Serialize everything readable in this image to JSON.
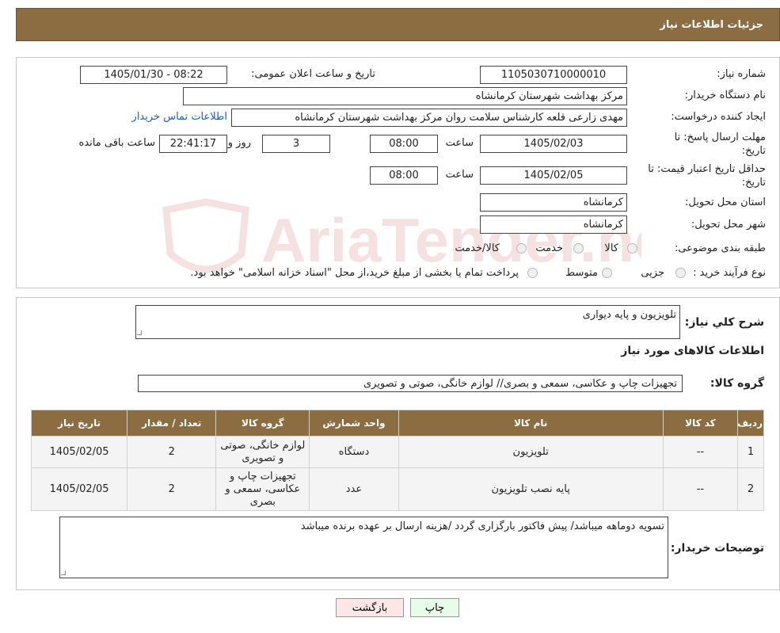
{
  "header": {
    "title": "جزئیات اطلاعات نیاز"
  },
  "watermark": {
    "text": "AriaTender.neT"
  },
  "form": {
    "need_number_label": "شماره نیاز:",
    "need_number": "1105030710000010",
    "announce_label": "تاریخ و ساعت اعلان عمومی:",
    "announce_value": "1405/01/30 - 08:22",
    "buyer_org_label": "نام دستگاه خریدار:",
    "buyer_org": "مرکز بهداشت شهرستان کرمانشاه",
    "creator_label": "ایجاد کننده درخواست:",
    "creator": "مهدی  زارعی قلعه کارشناس سلامت روان مرکز بهداشت شهرستان کرمانشاه",
    "contact_link": "اطلاعات تماس خریدار",
    "deadline_label_1": "مهلت ارسال پاسخ: تا",
    "deadline_label_2": "تاریخ:",
    "deadline_date": "1405/02/03",
    "time_label": "ساعت",
    "deadline_time": "08:00",
    "days": "3",
    "days_label": "روز و",
    "remaining_time": "22:41:17",
    "remaining_label": "ساعت باقی مانده",
    "validity_label_1": "حداقل تاریخ اعتبار قیمت: تا",
    "validity_label_2": "تاریخ:",
    "validity_date": "1405/02/05",
    "validity_time": "08:00",
    "province_label": "استان محل تحویل:",
    "province": "کرمانشاه",
    "city_label": "شهر محل تحویل:",
    "city": "کرمانشاه",
    "category_label": "طبقه بندی موضوعی:",
    "category_options": {
      "goods": "کالا",
      "service": "خدمت",
      "goods_service": "کالا/خدمت"
    },
    "process_label": "نوع فرآیند خرید :",
    "process_options": {
      "partial": "جزیی",
      "medium": "متوسط"
    },
    "payment_note": "پرداخت تمام یا بخشی از مبلغ خرید،از محل \"اسناد خزانه اسلامی\" خواهد بود."
  },
  "details": {
    "summary_label": "شرح کلي نیاز:",
    "summary": "تلویزیون و پایه دیواری",
    "goods_info_title": "اطلاعات کالاهای مورد نیاز",
    "goods_group_label": "گروه کالا:",
    "goods_group": "تجهیزات چاپ و عکاسی، سمعی و بصری// لوازم خانگی، صوتی و تصویری",
    "table": {
      "headers": [
        "ردیف",
        "کد کالا",
        "نام کالا",
        "واحد شمارش",
        "گروه کالا",
        "تعداد / مقدار",
        "تاریخ نیاز"
      ],
      "rows": [
        [
          "1",
          "--",
          "تلویزیون",
          "دستگاه",
          "لوازم خانگی، صوتی و تصویری",
          "2",
          "1405/02/05"
        ],
        [
          "2",
          "--",
          "پایه نصب تلویزیون",
          "عدد",
          "تجهیزات چاپ و عکاسی، سمعی و بصری",
          "2",
          "1405/02/05"
        ]
      ]
    },
    "buyer_notes_label": "توضیحات خریدار:",
    "buyer_notes": "تسویه دوماهه میباشد/ پیش فاکتور بارگزاری گردد /هزینه ارسال بر عهده برنده میباشد"
  },
  "buttons": {
    "print": "چاپ",
    "back": "بازگشت"
  },
  "colors": {
    "header_bg": "#8b6d41",
    "link": "#1a5ecf",
    "back_bg": "#fde6e6",
    "print_bg": "#e8fde8"
  }
}
